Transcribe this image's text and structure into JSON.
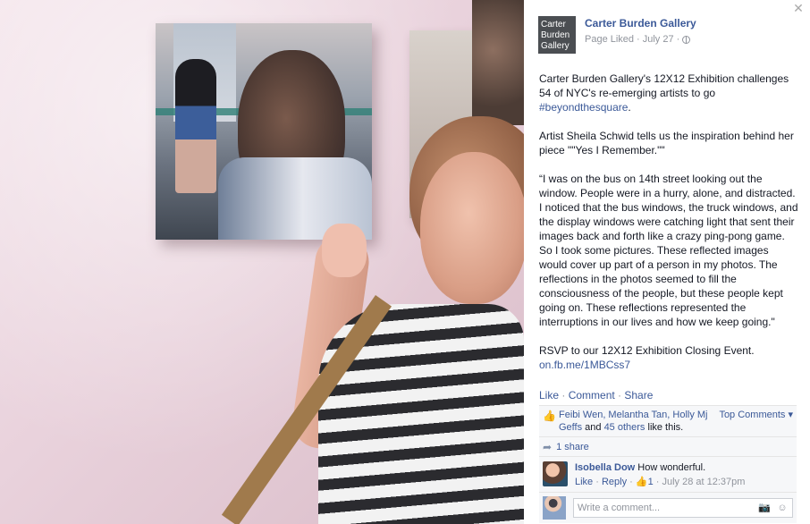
{
  "page": {
    "logo_lines": [
      "Carter",
      "Burden",
      "Gallery"
    ],
    "name": "Carter Burden Gallery",
    "liked_label": "Page Liked",
    "date": "July 27",
    "separator": "·"
  },
  "post": {
    "p1_text": "Carter Burden Gallery's 12X12 Exhibition challenges 54 of NYC's re-emerging artists to go ",
    "p1_hashtag": "#beyondthesquare",
    "p1_end": ".",
    "p2": "Artist Sheila Schwid tells us the inspiration behind her piece \"\"Yes I Remember.\"\"",
    "p3": "“I was on the bus on 14th street looking out the window. People were in a hurry, alone, and distracted. I noticed that the bus windows, the truck windows, and the display windows were catching light that sent their images back and forth like a crazy ping-pong game. So I took some pictures. These reflected images would cover up part of a person in my photos. The reflections in the photos seemed to fill the consciousness of the people, but these people kept going on. These reflections represented the interruptions in our lives and how we keep going.\"",
    "p4": "RSVP to our 12X12 Exhibition Closing Event.",
    "p4_link": "on.fb.me/1MBCss7"
  },
  "actions": {
    "like": "Like",
    "comment": "Comment",
    "share": "Share",
    "sep": " · "
  },
  "likes": {
    "names": "Feibi Wen, Melantha Tan, Holly Mj Geffs",
    "and": " and ",
    "others": "45 others",
    "suffix": " like this.",
    "top_comments": "Top Comments ▾"
  },
  "shares": {
    "label": "1 share"
  },
  "comment": {
    "author": "Isobella Dow",
    "text": " How wonderful.",
    "like": "Like",
    "reply": "Reply",
    "likes": "1",
    "time": "July 28 at 12:37pm",
    "sep": " · "
  },
  "composer": {
    "placeholder": "Write a comment..."
  },
  "icons": {
    "close": "close-icon",
    "globe": "globe-icon",
    "thumb": "thumbs-up-icon",
    "share": "share-arrow-icon",
    "camera": "camera-icon",
    "emoji": "emoji-icon"
  },
  "colors": {
    "link": "#3b5998",
    "meta": "#90949c",
    "panel": "#f6f7f9"
  }
}
